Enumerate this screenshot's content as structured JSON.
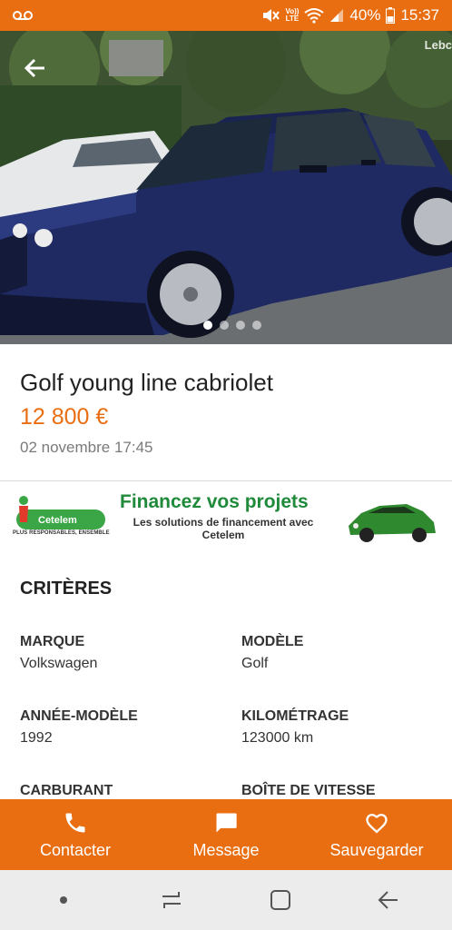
{
  "status_bar": {
    "voicemail_icon": "voicemail-icon",
    "volte_top": "Vo))",
    "volte_bottom": "LTE",
    "battery": "40%",
    "time": "15:37"
  },
  "hero": {
    "watermark": "Lebc",
    "page_count": 4,
    "active_page": 1
  },
  "listing": {
    "title": "Golf young line cabriolet",
    "price": "12 800 €",
    "date": "02 novembre 17:45"
  },
  "ad": {
    "brand": "Cetelem",
    "tagline": "PLUS RESPONSABLES, ENSEMBLE",
    "headline": "Financez vos projets",
    "subline": "Les solutions de financement avec Cetelem"
  },
  "criteria": {
    "heading": "CRITÈRES",
    "items": [
      {
        "label": "MARQUE",
        "value": "Volkswagen"
      },
      {
        "label": "MODÈLE",
        "value": "Golf"
      },
      {
        "label": "ANNÉE-MODÈLE",
        "value": "1992"
      },
      {
        "label": "KILOMÉTRAGE",
        "value": "123000 km"
      },
      {
        "label": "CARBURANT",
        "value": ""
      },
      {
        "label": "BOÎTE DE VITESSE",
        "value": ""
      }
    ]
  },
  "actions": {
    "contact": "Contacter",
    "message": "Message",
    "save": "Sauvegarder"
  },
  "colors": {
    "brand_orange": "#e96e12",
    "ad_green": "#1f8a3a"
  }
}
